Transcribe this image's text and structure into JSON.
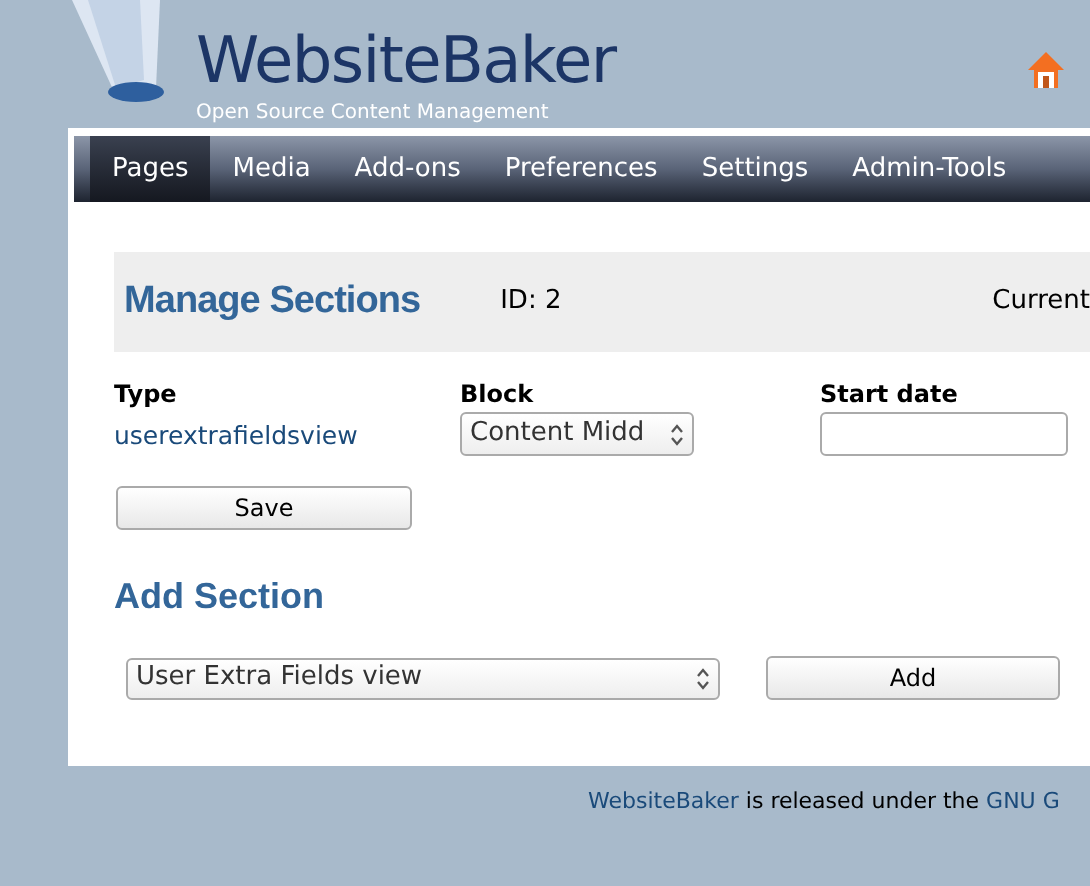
{
  "header": {
    "title": "WebsiteBaker",
    "subtitle": "Open Source Content Management"
  },
  "nav": [
    {
      "label": "Pages",
      "selected": true
    },
    {
      "label": "Media",
      "selected": false
    },
    {
      "label": "Add-ons",
      "selected": false
    },
    {
      "label": "Preferences",
      "selected": false
    },
    {
      "label": "Settings",
      "selected": false
    },
    {
      "label": "Admin-Tools",
      "selected": false
    }
  ],
  "manage": {
    "title": "Manage Sections",
    "id": "ID: 2",
    "current": "Current"
  },
  "section": {
    "type_label": "Type",
    "type_value": "userextrafieldsview",
    "block_label": "Block",
    "block_value": "Content Midd",
    "start_label": "Start date",
    "save": "Save"
  },
  "add": {
    "title": "Add Section",
    "module": "User Extra Fields view",
    "button": "Add"
  },
  "footer": {
    "link": "WebsiteBaker",
    "text": "is released under the",
    "license": "GNU G"
  }
}
